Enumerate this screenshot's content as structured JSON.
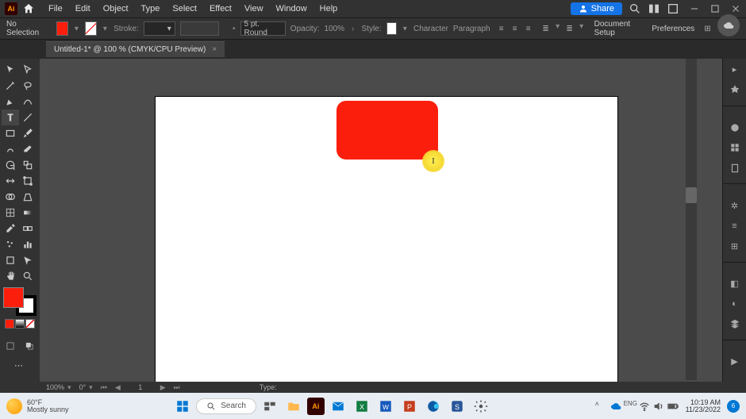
{
  "app": {
    "logo": "Ai"
  },
  "menu": {
    "file": "File",
    "edit": "Edit",
    "object": "Object",
    "type": "Type",
    "select": "Select",
    "effect": "Effect",
    "view": "View",
    "window": "Window",
    "help": "Help"
  },
  "share": {
    "label": "Share"
  },
  "ctrl": {
    "no_selection": "No Selection",
    "stroke_label": "Stroke:",
    "stroke_val": "",
    "round_val": "5 pt. Round",
    "opacity_label": "Opacity:",
    "opacity_val": "100%",
    "style_label": "Style:",
    "char_label": "Character",
    "para_label": "Paragraph",
    "doc_setup": "Document Setup",
    "prefs": "Preferences"
  },
  "tab": {
    "title": "Untitled-1* @ 100 % (CMYK/CPU Preview)",
    "close": "×"
  },
  "colors": {
    "fill": "#fb1e0d"
  },
  "artboard_shape": {
    "type": "rounded-rectangle",
    "fill": "#fb1e0d"
  },
  "cursor": {
    "glyph": "I",
    "hint": "text-cursor"
  },
  "status": {
    "zoom": "100%",
    "rot": "0°",
    "page": "1",
    "type_label": "Type:"
  },
  "taskbar": {
    "temp": "60°F",
    "cond": "Mostly sunny",
    "search": "Search",
    "time": "10:19 AM",
    "date": "11/23/2022",
    "notif": "6"
  }
}
